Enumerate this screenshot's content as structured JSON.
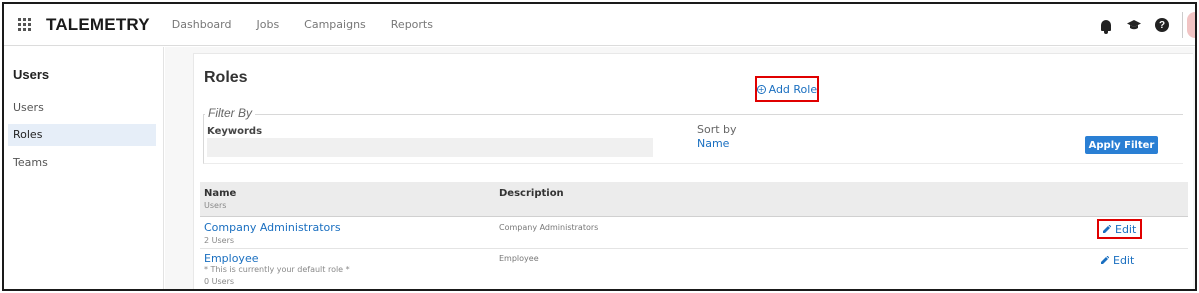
{
  "app": {
    "brand": "TALEMETRY"
  },
  "nav": {
    "items": [
      "Dashboard",
      "Jobs",
      "Campaigns",
      "Reports"
    ]
  },
  "top_icons": [
    "bell-icon",
    "graduation-cap-icon",
    "help-icon"
  ],
  "sidebar": {
    "title": "Users",
    "items": [
      {
        "label": "Users",
        "active": false
      },
      {
        "label": "Roles",
        "active": true
      },
      {
        "label": "Teams",
        "active": false
      }
    ]
  },
  "page": {
    "title": "Roles",
    "add_role_label": "Add Role"
  },
  "filter": {
    "legend": "Filter By",
    "keywords_label": "Keywords",
    "keywords_value": "",
    "sort_label": "Sort by",
    "sort_value": "Name",
    "apply_label": "Apply Filter"
  },
  "table": {
    "columns": {
      "name": "Name",
      "name_sub": "Users",
      "description": "Description"
    },
    "rows": [
      {
        "name": "Company Administrators",
        "note": "",
        "users": "2 Users",
        "description": "Company Administrators",
        "edit_label": "Edit"
      },
      {
        "name": "Employee",
        "note": "* This is currently your default role *",
        "users": "0 Users",
        "description": "Employee",
        "edit_label": "Edit"
      }
    ]
  },
  "colors": {
    "accent": "#1a6fc0",
    "highlight_box": "#e00000",
    "button": "#2a7fd4",
    "active_sidebar": "#e6eef8"
  }
}
